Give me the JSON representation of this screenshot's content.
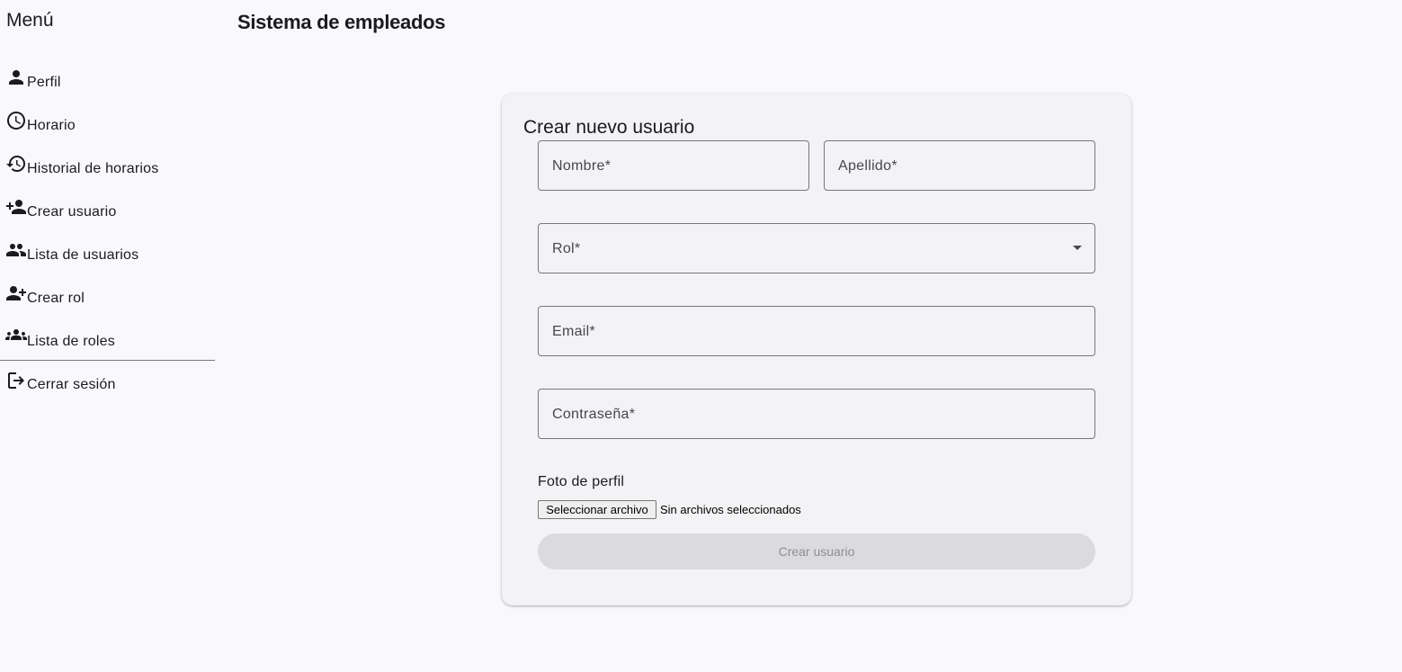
{
  "sidebar": {
    "title": "Menú",
    "items": [
      {
        "label": "Perfil",
        "icon": "person-icon"
      },
      {
        "label": "Horario",
        "icon": "clock-icon"
      },
      {
        "label": "Historial de horarios",
        "icon": "history-icon"
      },
      {
        "label": "Crear usuario",
        "icon": "person-add-icon"
      },
      {
        "label": "Lista de usuarios",
        "icon": "people-icon"
      },
      {
        "label": "Crear rol",
        "icon": "group-add-icon"
      },
      {
        "label": "Lista de roles",
        "icon": "groups-icon"
      }
    ],
    "logout": {
      "label": "Cerrar sesión",
      "icon": "logout-icon"
    }
  },
  "header": {
    "title": "Sistema de empleados"
  },
  "form": {
    "title": "Crear nuevo usuario",
    "first_name": {
      "placeholder": "Nombre*",
      "value": ""
    },
    "last_name": {
      "placeholder": "Apellido*",
      "value": ""
    },
    "role": {
      "placeholder": "Rol*",
      "value": ""
    },
    "email": {
      "placeholder": "Email*",
      "value": ""
    },
    "password": {
      "placeholder": "Contraseña*",
      "value": ""
    },
    "photo_label": "Foto de perfil",
    "file_button": "Seleccionar archivo",
    "file_status": "Sin archivos seleccionados",
    "submit_label": "Crear usuario"
  },
  "colors": {
    "background": "#f9f9fd",
    "card": "#f3f3f5",
    "outline": "#77767c",
    "disabled_button": "#dadadf"
  }
}
